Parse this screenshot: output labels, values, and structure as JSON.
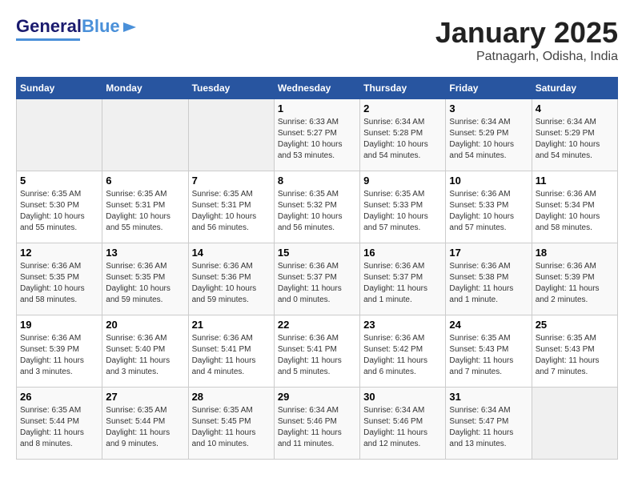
{
  "header": {
    "logo_general": "General",
    "logo_blue": "Blue",
    "month_title": "January 2025",
    "location": "Patnagarh, Odisha, India"
  },
  "days_of_week": [
    "Sunday",
    "Monday",
    "Tuesday",
    "Wednesday",
    "Thursday",
    "Friday",
    "Saturday"
  ],
  "weeks": [
    [
      {
        "day": "",
        "info": ""
      },
      {
        "day": "",
        "info": ""
      },
      {
        "day": "",
        "info": ""
      },
      {
        "day": "1",
        "info": "Sunrise: 6:33 AM\nSunset: 5:27 PM\nDaylight: 10 hours\nand 53 minutes."
      },
      {
        "day": "2",
        "info": "Sunrise: 6:34 AM\nSunset: 5:28 PM\nDaylight: 10 hours\nand 54 minutes."
      },
      {
        "day": "3",
        "info": "Sunrise: 6:34 AM\nSunset: 5:29 PM\nDaylight: 10 hours\nand 54 minutes."
      },
      {
        "day": "4",
        "info": "Sunrise: 6:34 AM\nSunset: 5:29 PM\nDaylight: 10 hours\nand 54 minutes."
      }
    ],
    [
      {
        "day": "5",
        "info": "Sunrise: 6:35 AM\nSunset: 5:30 PM\nDaylight: 10 hours\nand 55 minutes."
      },
      {
        "day": "6",
        "info": "Sunrise: 6:35 AM\nSunset: 5:31 PM\nDaylight: 10 hours\nand 55 minutes."
      },
      {
        "day": "7",
        "info": "Sunrise: 6:35 AM\nSunset: 5:31 PM\nDaylight: 10 hours\nand 56 minutes."
      },
      {
        "day": "8",
        "info": "Sunrise: 6:35 AM\nSunset: 5:32 PM\nDaylight: 10 hours\nand 56 minutes."
      },
      {
        "day": "9",
        "info": "Sunrise: 6:35 AM\nSunset: 5:33 PM\nDaylight: 10 hours\nand 57 minutes."
      },
      {
        "day": "10",
        "info": "Sunrise: 6:36 AM\nSunset: 5:33 PM\nDaylight: 10 hours\nand 57 minutes."
      },
      {
        "day": "11",
        "info": "Sunrise: 6:36 AM\nSunset: 5:34 PM\nDaylight: 10 hours\nand 58 minutes."
      }
    ],
    [
      {
        "day": "12",
        "info": "Sunrise: 6:36 AM\nSunset: 5:35 PM\nDaylight: 10 hours\nand 58 minutes."
      },
      {
        "day": "13",
        "info": "Sunrise: 6:36 AM\nSunset: 5:35 PM\nDaylight: 10 hours\nand 59 minutes."
      },
      {
        "day": "14",
        "info": "Sunrise: 6:36 AM\nSunset: 5:36 PM\nDaylight: 10 hours\nand 59 minutes."
      },
      {
        "day": "15",
        "info": "Sunrise: 6:36 AM\nSunset: 5:37 PM\nDaylight: 11 hours\nand 0 minutes."
      },
      {
        "day": "16",
        "info": "Sunrise: 6:36 AM\nSunset: 5:37 PM\nDaylight: 11 hours\nand 1 minute."
      },
      {
        "day": "17",
        "info": "Sunrise: 6:36 AM\nSunset: 5:38 PM\nDaylight: 11 hours\nand 1 minute."
      },
      {
        "day": "18",
        "info": "Sunrise: 6:36 AM\nSunset: 5:39 PM\nDaylight: 11 hours\nand 2 minutes."
      }
    ],
    [
      {
        "day": "19",
        "info": "Sunrise: 6:36 AM\nSunset: 5:39 PM\nDaylight: 11 hours\nand 3 minutes."
      },
      {
        "day": "20",
        "info": "Sunrise: 6:36 AM\nSunset: 5:40 PM\nDaylight: 11 hours\nand 3 minutes."
      },
      {
        "day": "21",
        "info": "Sunrise: 6:36 AM\nSunset: 5:41 PM\nDaylight: 11 hours\nand 4 minutes."
      },
      {
        "day": "22",
        "info": "Sunrise: 6:36 AM\nSunset: 5:41 PM\nDaylight: 11 hours\nand 5 minutes."
      },
      {
        "day": "23",
        "info": "Sunrise: 6:36 AM\nSunset: 5:42 PM\nDaylight: 11 hours\nand 6 minutes."
      },
      {
        "day": "24",
        "info": "Sunrise: 6:35 AM\nSunset: 5:43 PM\nDaylight: 11 hours\nand 7 minutes."
      },
      {
        "day": "25",
        "info": "Sunrise: 6:35 AM\nSunset: 5:43 PM\nDaylight: 11 hours\nand 7 minutes."
      }
    ],
    [
      {
        "day": "26",
        "info": "Sunrise: 6:35 AM\nSunset: 5:44 PM\nDaylight: 11 hours\nand 8 minutes."
      },
      {
        "day": "27",
        "info": "Sunrise: 6:35 AM\nSunset: 5:44 PM\nDaylight: 11 hours\nand 9 minutes."
      },
      {
        "day": "28",
        "info": "Sunrise: 6:35 AM\nSunset: 5:45 PM\nDaylight: 11 hours\nand 10 minutes."
      },
      {
        "day": "29",
        "info": "Sunrise: 6:34 AM\nSunset: 5:46 PM\nDaylight: 11 hours\nand 11 minutes."
      },
      {
        "day": "30",
        "info": "Sunrise: 6:34 AM\nSunset: 5:46 PM\nDaylight: 11 hours\nand 12 minutes."
      },
      {
        "day": "31",
        "info": "Sunrise: 6:34 AM\nSunset: 5:47 PM\nDaylight: 11 hours\nand 13 minutes."
      },
      {
        "day": "",
        "info": ""
      }
    ]
  ]
}
